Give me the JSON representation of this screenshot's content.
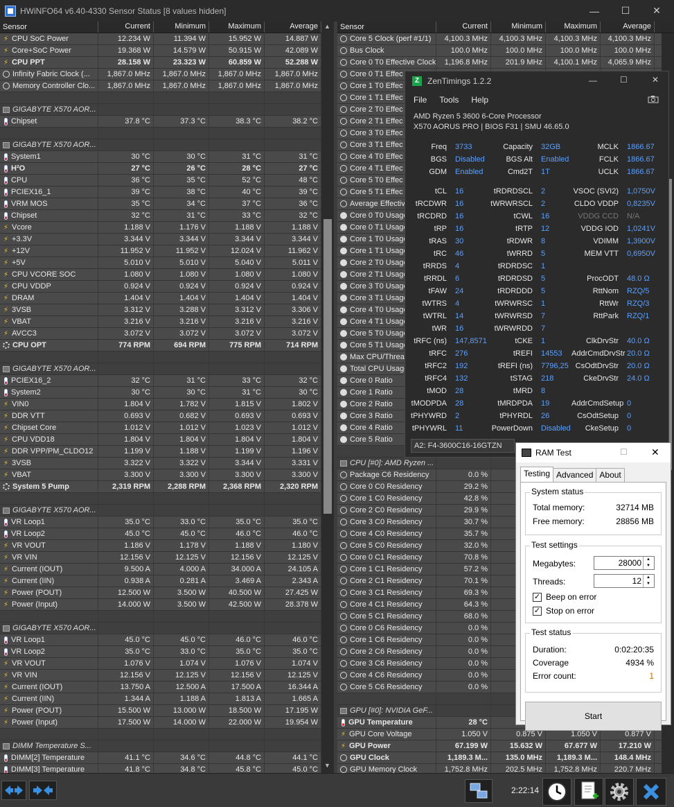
{
  "window": {
    "title": "HWiNFO64 v6.40-4330 Sensor Status [8 values hidden]"
  },
  "headers": {
    "sensor": "Sensor",
    "current": "Current",
    "minimum": "Minimum",
    "maximum": "Maximum",
    "average": "Average"
  },
  "left": [
    {
      "icon": "bolt",
      "name": "CPU SoC Power",
      "cur": "12.234 W",
      "min": "11.394 W",
      "max": "15.952 W",
      "avg": "14.887 W"
    },
    {
      "icon": "bolt",
      "name": "Core+SoC Power",
      "cur": "19.368 W",
      "min": "14.579 W",
      "max": "50.915 W",
      "avg": "42.089 W"
    },
    {
      "icon": "bolt",
      "name": "CPU PPT",
      "cur": "28.158 W",
      "min": "23.323 W",
      "max": "60.859 W",
      "avg": "52.288 W",
      "bold": true
    },
    {
      "icon": "clock",
      "name": "Infinity Fabric Clock (...",
      "cur": "1,867.0 MHz",
      "min": "1,867.0 MHz",
      "max": "1,867.0 MHz",
      "avg": "1,867.0 MHz"
    },
    {
      "icon": "clock",
      "name": "Memory Controller Clo...",
      "cur": "1,867.0 MHz",
      "min": "1,867.0 MHz",
      "max": "1,867.0 MHz",
      "avg": "1,867.0 MHz"
    },
    {
      "blank": true
    },
    {
      "group": true,
      "name": "GIGABYTE X570 AOR..."
    },
    {
      "icon": "therm",
      "name": "Chipset",
      "cur": "37.8 °C",
      "min": "37.3 °C",
      "max": "38.3 °C",
      "avg": "38.2 °C"
    },
    {
      "blank": true
    },
    {
      "group": true,
      "name": "GIGABYTE X570 AOR..."
    },
    {
      "icon": "therm",
      "name": "System1",
      "cur": "30 °C",
      "min": "30 °C",
      "max": "31 °C",
      "avg": "31 °C"
    },
    {
      "icon": "therm",
      "name": "H²O",
      "cur": "27 °C",
      "min": "26 °C",
      "max": "28 °C",
      "avg": "27 °C",
      "bold": true
    },
    {
      "icon": "therm",
      "name": "CPU",
      "cur": "36 °C",
      "min": "35 °C",
      "max": "52 °C",
      "avg": "48 °C"
    },
    {
      "icon": "therm",
      "name": "PCIEX16_1",
      "cur": "39 °C",
      "min": "38 °C",
      "max": "40 °C",
      "avg": "39 °C"
    },
    {
      "icon": "therm",
      "name": "VRM MOS",
      "cur": "35 °C",
      "min": "34 °C",
      "max": "37 °C",
      "avg": "36 °C"
    },
    {
      "icon": "therm",
      "name": "Chipset",
      "cur": "32 °C",
      "min": "31 °C",
      "max": "33 °C",
      "avg": "32 °C"
    },
    {
      "icon": "bolt",
      "name": "Vcore",
      "cur": "1.188 V",
      "min": "1.176 V",
      "max": "1.188 V",
      "avg": "1.188 V"
    },
    {
      "icon": "bolt",
      "name": "+3.3V",
      "cur": "3.344 V",
      "min": "3.344 V",
      "max": "3.344 V",
      "avg": "3.344 V"
    },
    {
      "icon": "bolt",
      "name": "+12V",
      "cur": "11.952 V",
      "min": "11.952 V",
      "max": "12.024 V",
      "avg": "11.962 V"
    },
    {
      "icon": "bolt",
      "name": "+5V",
      "cur": "5.010 V",
      "min": "5.010 V",
      "max": "5.040 V",
      "avg": "5.011 V"
    },
    {
      "icon": "bolt",
      "name": "CPU VCORE SOC",
      "cur": "1.080 V",
      "min": "1.080 V",
      "max": "1.080 V",
      "avg": "1.080 V"
    },
    {
      "icon": "bolt",
      "name": "CPU VDDP",
      "cur": "0.924 V",
      "min": "0.924 V",
      "max": "0.924 V",
      "avg": "0.924 V"
    },
    {
      "icon": "bolt",
      "name": "DRAM",
      "cur": "1.404 V",
      "min": "1.404 V",
      "max": "1.404 V",
      "avg": "1.404 V"
    },
    {
      "icon": "bolt",
      "name": "3VSB",
      "cur": "3.312 V",
      "min": "3.288 V",
      "max": "3.312 V",
      "avg": "3.306 V"
    },
    {
      "icon": "bolt",
      "name": "VBAT",
      "cur": "3.216 V",
      "min": "3.216 V",
      "max": "3.216 V",
      "avg": "3.216 V"
    },
    {
      "icon": "bolt",
      "name": "AVCC3",
      "cur": "3.072 V",
      "min": "3.072 V",
      "max": "3.072 V",
      "avg": "3.072 V"
    },
    {
      "icon": "fan",
      "name": "CPU OPT",
      "cur": "774 RPM",
      "min": "694 RPM",
      "max": "775 RPM",
      "avg": "714 RPM",
      "bold": true
    },
    {
      "blank": true
    },
    {
      "group": true,
      "name": "GIGABYTE X570 AOR..."
    },
    {
      "icon": "therm",
      "name": "PCIEX16_2",
      "cur": "32 °C",
      "min": "31 °C",
      "max": "33 °C",
      "avg": "32 °C"
    },
    {
      "icon": "therm",
      "name": "System2",
      "cur": "30 °C",
      "min": "30 °C",
      "max": "31 °C",
      "avg": "30 °C"
    },
    {
      "icon": "bolt",
      "name": "VIN0",
      "cur": "1.804 V",
      "min": "1.782 V",
      "max": "1.815 V",
      "avg": "1.802 V"
    },
    {
      "icon": "bolt",
      "name": "DDR VTT",
      "cur": "0.693 V",
      "min": "0.682 V",
      "max": "0.693 V",
      "avg": "0.693 V"
    },
    {
      "icon": "bolt",
      "name": "Chipset Core",
      "cur": "1.012 V",
      "min": "1.012 V",
      "max": "1.023 V",
      "avg": "1.012 V"
    },
    {
      "icon": "bolt",
      "name": "CPU VDD18",
      "cur": "1.804 V",
      "min": "1.804 V",
      "max": "1.804 V",
      "avg": "1.804 V"
    },
    {
      "icon": "bolt",
      "name": "DDR VPP/PM_CLDO12",
      "cur": "1.199 V",
      "min": "1.188 V",
      "max": "1.199 V",
      "avg": "1.196 V"
    },
    {
      "icon": "bolt",
      "name": "3VSB",
      "cur": "3.322 V",
      "min": "3.322 V",
      "max": "3.344 V",
      "avg": "3.331 V"
    },
    {
      "icon": "bolt",
      "name": "VBAT",
      "cur": "3.300 V",
      "min": "3.300 V",
      "max": "3.300 V",
      "avg": "3.300 V"
    },
    {
      "icon": "fan",
      "name": "System 5 Pump",
      "cur": "2,319 RPM",
      "min": "2,288 RPM",
      "max": "2,368 RPM",
      "avg": "2,320 RPM",
      "bold": true
    },
    {
      "blank": true
    },
    {
      "group": true,
      "name": "GIGABYTE X570 AOR..."
    },
    {
      "icon": "therm",
      "name": "VR Loop1",
      "cur": "35.0 °C",
      "min": "33.0 °C",
      "max": "35.0 °C",
      "avg": "35.0 °C"
    },
    {
      "icon": "therm",
      "name": "VR Loop2",
      "cur": "45.0 °C",
      "min": "45.0 °C",
      "max": "46.0 °C",
      "avg": "46.0 °C"
    },
    {
      "icon": "bolt",
      "name": "VR VOUT",
      "cur": "1.186 V",
      "min": "1.178 V",
      "max": "1.188 V",
      "avg": "1.180 V"
    },
    {
      "icon": "bolt",
      "name": "VR VIN",
      "cur": "12.156 V",
      "min": "12.125 V",
      "max": "12.156 V",
      "avg": "12.125 V"
    },
    {
      "icon": "bolt",
      "name": "Current (IOUT)",
      "cur": "9.500 A",
      "min": "4.000 A",
      "max": "34.000 A",
      "avg": "24.105 A"
    },
    {
      "icon": "bolt",
      "name": "Current (IIN)",
      "cur": "0.938 A",
      "min": "0.281 A",
      "max": "3.469 A",
      "avg": "2.343 A"
    },
    {
      "icon": "bolt",
      "name": "Power (POUT)",
      "cur": "12.500 W",
      "min": "3.500 W",
      "max": "40.500 W",
      "avg": "27.425 W"
    },
    {
      "icon": "bolt",
      "name": "Power (Input)",
      "cur": "14.000 W",
      "min": "3.500 W",
      "max": "42.500 W",
      "avg": "28.378 W"
    },
    {
      "blank": true
    },
    {
      "group": true,
      "name": "GIGABYTE X570 AOR..."
    },
    {
      "icon": "therm",
      "name": "VR Loop1",
      "cur": "45.0 °C",
      "min": "45.0 °C",
      "max": "46.0 °C",
      "avg": "46.0 °C"
    },
    {
      "icon": "therm",
      "name": "VR Loop2",
      "cur": "35.0 °C",
      "min": "33.0 °C",
      "max": "35.0 °C",
      "avg": "35.0 °C"
    },
    {
      "icon": "bolt",
      "name": "VR VOUT",
      "cur": "1.076 V",
      "min": "1.074 V",
      "max": "1.076 V",
      "avg": "1.074 V"
    },
    {
      "icon": "bolt",
      "name": "VR VIN",
      "cur": "12.156 V",
      "min": "12.125 V",
      "max": "12.156 V",
      "avg": "12.125 V"
    },
    {
      "icon": "bolt",
      "name": "Current (IOUT)",
      "cur": "13.750 A",
      "min": "12.500 A",
      "max": "17.500 A",
      "avg": "16.344 A"
    },
    {
      "icon": "bolt",
      "name": "Current (IIN)",
      "cur": "1.344 A",
      "min": "1.188 A",
      "max": "1.813 A",
      "avg": "1.665 A"
    },
    {
      "icon": "bolt",
      "name": "Power (POUT)",
      "cur": "15.500 W",
      "min": "13.000 W",
      "max": "18.500 W",
      "avg": "17.195 W"
    },
    {
      "icon": "bolt",
      "name": "Power (Input)",
      "cur": "17.500 W",
      "min": "14.000 W",
      "max": "22.000 W",
      "avg": "19.954 W"
    },
    {
      "blank": true
    },
    {
      "group": true,
      "name": "DIMM Temperature S..."
    },
    {
      "icon": "therm",
      "name": "DIMM[2] Temperature",
      "cur": "41.1 °C",
      "min": "34.6 °C",
      "max": "44.8 °C",
      "avg": "44.1 °C"
    },
    {
      "icon": "therm",
      "name": "DIMM[3] Temperature",
      "cur": "41.8 °C",
      "min": "34.8 °C",
      "max": "45.8 °C",
      "avg": "45.0 °C"
    }
  ],
  "right": [
    {
      "icon": "clock",
      "name": "Core 5 Clock (perf #1/1)",
      "cur": "4,100.3 MHz",
      "min": "4,100.3 MHz",
      "max": "4,100.3 MHz",
      "avg": "4,100.3 MHz"
    },
    {
      "icon": "clock",
      "name": "Bus Clock",
      "cur": "100.0 MHz",
      "min": "100.0 MHz",
      "max": "100.0 MHz",
      "avg": "100.0 MHz"
    },
    {
      "icon": "clock",
      "name": "Core 0 T0 Effective Clock",
      "cur": "1,196.8 MHz",
      "min": "201.9 MHz",
      "max": "4,100.1 MHz",
      "avg": "4,065.9 MHz"
    },
    {
      "icon": "clock",
      "name": "Core 0 T1 Effec"
    },
    {
      "icon": "clock",
      "name": "Core 1 T0 Effec"
    },
    {
      "icon": "clock",
      "name": "Core 1 T1 Effec"
    },
    {
      "icon": "clock",
      "name": "Core 2 T0 Effec"
    },
    {
      "icon": "clock",
      "name": "Core 2 T1 Effec"
    },
    {
      "icon": "clock",
      "name": "Core 3 T0 Effec"
    },
    {
      "icon": "clock",
      "name": "Core 3 T1 Effec"
    },
    {
      "icon": "clock",
      "name": "Core 4 T0 Effec"
    },
    {
      "icon": "clock",
      "name": "Core 4 T1 Effec"
    },
    {
      "icon": "clock",
      "name": "Core 5 T0 Effec"
    },
    {
      "icon": "clock",
      "name": "Core 5 T1 Effec"
    },
    {
      "icon": "clock",
      "name": "Average Effectiv"
    },
    {
      "icon": "pct",
      "name": "Core 0 T0 Usage"
    },
    {
      "icon": "pct",
      "name": "Core 0 T1 Usage"
    },
    {
      "icon": "pct",
      "name": "Core 1 T0 Usage"
    },
    {
      "icon": "pct",
      "name": "Core 1 T1 Usage"
    },
    {
      "icon": "pct",
      "name": "Core 2 T0 Usage"
    },
    {
      "icon": "pct",
      "name": "Core 2 T1 Usage"
    },
    {
      "icon": "pct",
      "name": "Core 3 T0 Usage"
    },
    {
      "icon": "pct",
      "name": "Core 3 T1 Usage"
    },
    {
      "icon": "pct",
      "name": "Core 4 T0 Usage"
    },
    {
      "icon": "pct",
      "name": "Core 4 T1 Usage"
    },
    {
      "icon": "pct",
      "name": "Core 5 T0 Usage"
    },
    {
      "icon": "pct",
      "name": "Core 5 T1 Usage"
    },
    {
      "icon": "pct",
      "name": "Max CPU/Thread"
    },
    {
      "icon": "pct",
      "name": "Total CPU Usage"
    },
    {
      "icon": "pct",
      "name": "Core 0 Ratio"
    },
    {
      "icon": "pct",
      "name": "Core 1 Ratio"
    },
    {
      "icon": "pct",
      "name": "Core 2 Ratio"
    },
    {
      "icon": "pct",
      "name": "Core 3 Ratio"
    },
    {
      "icon": "pct",
      "name": "Core 4 Ratio"
    },
    {
      "icon": "pct",
      "name": "Core 5 Ratio"
    },
    {
      "blank": true
    },
    {
      "group": true,
      "name": "CPU [#0]: AMD Ryzen ..."
    },
    {
      "icon": "clock",
      "name": "Package C6 Residency",
      "cur": "0.0 %"
    },
    {
      "icon": "clock",
      "name": "Core 0 C0 Residency",
      "cur": "29.2 %"
    },
    {
      "icon": "clock",
      "name": "Core 1 C0 Residency",
      "cur": "42.8 %"
    },
    {
      "icon": "clock",
      "name": "Core 2 C0 Residency",
      "cur": "29.9 %"
    },
    {
      "icon": "clock",
      "name": "Core 3 C0 Residency",
      "cur": "30.7 %"
    },
    {
      "icon": "clock",
      "name": "Core 4 C0 Residency",
      "cur": "35.7 %"
    },
    {
      "icon": "clock",
      "name": "Core 5 C0 Residency",
      "cur": "32.0 %"
    },
    {
      "icon": "clock",
      "name": "Core 0 C1 Residency",
      "cur": "70.8 %"
    },
    {
      "icon": "clock",
      "name": "Core 1 C1 Residency",
      "cur": "57.2 %"
    },
    {
      "icon": "clock",
      "name": "Core 2 C1 Residency",
      "cur": "70.1 %"
    },
    {
      "icon": "clock",
      "name": "Core 3 C1 Residency",
      "cur": "69.3 %"
    },
    {
      "icon": "clock",
      "name": "Core 4 C1 Residency",
      "cur": "64.3 %"
    },
    {
      "icon": "clock",
      "name": "Core 5 C1 Residency",
      "cur": "68.0 %"
    },
    {
      "icon": "clock",
      "name": "Core 0 C6 Residency",
      "cur": "0.0 %"
    },
    {
      "icon": "clock",
      "name": "Core 1 C6 Residency",
      "cur": "0.0 %"
    },
    {
      "icon": "clock",
      "name": "Core 2 C6 Residency",
      "cur": "0.0 %"
    },
    {
      "icon": "clock",
      "name": "Core 3 C6 Residency",
      "cur": "0.0 %"
    },
    {
      "icon": "clock",
      "name": "Core 4 C6 Residency",
      "cur": "0.0 %"
    },
    {
      "icon": "clock",
      "name": "Core 5 C6 Residency",
      "cur": "0.0 %"
    },
    {
      "blank": true
    },
    {
      "group": true,
      "name": "GPU [#0]: NVIDIA GeF..."
    },
    {
      "icon": "therm",
      "name": "GPU Temperature",
      "cur": "28 °C",
      "bold": true
    },
    {
      "icon": "bolt",
      "name": "GPU Core Voltage",
      "cur": "1.050 V",
      "min": "0.875 V",
      "max": "1.050 V",
      "avg": "0.877 V"
    },
    {
      "icon": "bolt",
      "name": "GPU Power",
      "cur": "67.199 W",
      "min": "15.632 W",
      "max": "67.677 W",
      "avg": "17.210 W",
      "bold": true
    },
    {
      "icon": "clock",
      "name": "GPU Clock",
      "cur": "1,189.3 M...",
      "min": "135.0 MHz",
      "max": "1,189.3 M...",
      "avg": "148.4 MHz",
      "bold": true
    },
    {
      "icon": "clock",
      "name": "GPU Memory Clock",
      "cur": "1,752.8 MHz",
      "min": "202.5 MHz",
      "max": "1,752.8 MHz",
      "avg": "220.7 MHz"
    }
  ],
  "status": {
    "time": "2:22:14"
  },
  "zentimings": {
    "title": "ZenTimings 1.2.2",
    "menu": [
      "File",
      "Tools",
      "Help"
    ],
    "cpu": "AMD Ryzen 5 3600 6-Core Processor",
    "board": "X570 AORUS PRO | BIOS F31 | SMU 46.65.0",
    "rows": [
      [
        [
          "Freq",
          "3733"
        ],
        [
          "Capacity",
          "32GB"
        ],
        [
          "MCLK",
          "1866.67"
        ]
      ],
      [
        [
          "BGS",
          "Disabled"
        ],
        [
          "BGS Alt",
          "Enabled"
        ],
        [
          "FCLK",
          "1866.67"
        ]
      ],
      [
        [
          "GDM",
          "Enabled"
        ],
        [
          "Cmd2T",
          "1T"
        ],
        [
          "UCLK",
          "1866.67"
        ]
      ],
      "gap",
      [
        [
          "tCL",
          "16"
        ],
        [
          "tRDRDSCL",
          "2"
        ],
        [
          "VSOC (SVI2)",
          "1,0750V"
        ]
      ],
      [
        [
          "tRCDWR",
          "16"
        ],
        [
          "tWRWRSCL",
          "2"
        ],
        [
          "CLDO VDDP",
          "0,8235V"
        ]
      ],
      [
        [
          "tRCDRD",
          "16"
        ],
        [
          "tCWL",
          "16"
        ],
        [
          "VDDG CCD",
          "N/A"
        ]
      ],
      [
        [
          "tRP",
          "16"
        ],
        [
          "tRTP",
          "12"
        ],
        [
          "VDDG IOD",
          "1,0241V"
        ]
      ],
      [
        [
          "tRAS",
          "30"
        ],
        [
          "tRDWR",
          "8"
        ],
        [
          "VDIMM",
          "1,3900V"
        ]
      ],
      [
        [
          "tRC",
          "46"
        ],
        [
          "tWRRD",
          "5"
        ],
        [
          "MEM VTT",
          "0,6950V"
        ]
      ],
      [
        [
          "tRRDS",
          "4"
        ],
        [
          "tRDRDSC",
          "1"
        ],
        [
          "",
          ""
        ]
      ],
      [
        [
          "tRRDL",
          "6"
        ],
        [
          "tRDRDSD",
          "5"
        ],
        [
          "ProcODT",
          "48.0 Ω"
        ]
      ],
      [
        [
          "tFAW",
          "24"
        ],
        [
          "tRDRDDD",
          "5"
        ],
        [
          "RttNom",
          "RZQ/5"
        ]
      ],
      [
        [
          "tWTRS",
          "4"
        ],
        [
          "tWRWRSC",
          "1"
        ],
        [
          "RttWr",
          "RZQ/3"
        ]
      ],
      [
        [
          "tWTRL",
          "14"
        ],
        [
          "tWRWRSD",
          "7"
        ],
        [
          "RttPark",
          "RZQ/1"
        ]
      ],
      [
        [
          "tWR",
          "16"
        ],
        [
          "tWRWRDD",
          "7"
        ],
        [
          "",
          ""
        ]
      ],
      [
        [
          "tRFC (ns)",
          "147,8571"
        ],
        [
          "tCKE",
          "1"
        ],
        [
          "ClkDrvStr",
          "40.0 Ω"
        ]
      ],
      [
        [
          "tRFC",
          "276"
        ],
        [
          "tREFI",
          "14553"
        ],
        [
          "AddrCmdDrvStr",
          "20.0 Ω"
        ]
      ],
      [
        [
          "tRFC2",
          "192"
        ],
        [
          "tREFI (ns)",
          "7796,25"
        ],
        [
          "CsOdtDrvStr",
          "20.0 Ω"
        ]
      ],
      [
        [
          "tRFC4",
          "132"
        ],
        [
          "tSTAG",
          "218"
        ],
        [
          "CkeDrvStr",
          "24.0 Ω"
        ]
      ],
      [
        [
          "tMOD",
          "28"
        ],
        [
          "tMRD",
          "8"
        ],
        [
          "",
          ""
        ]
      ],
      [
        [
          "tMODPDA",
          "28"
        ],
        [
          "tMRDPDA",
          "19"
        ],
        [
          "AddrCmdSetup",
          "0"
        ]
      ],
      [
        [
          "tPHYWRD",
          "2"
        ],
        [
          "tPHYRDL",
          "26"
        ],
        [
          "CsOdtSetup",
          "0"
        ]
      ],
      [
        [
          "tPHYWRL",
          "11"
        ],
        [
          "PowerDown",
          "Disabled"
        ],
        [
          "CkeSetup",
          "0"
        ]
      ]
    ],
    "combo": "A2: F4-3600C16-16GTZN"
  },
  "ramtest": {
    "title": "RAM Test",
    "tabs": [
      "Testing",
      "Advanced",
      "About"
    ],
    "system_status": "System status",
    "total_label": "Total memory:",
    "total": "32714 MB",
    "free_label": "Free memory:",
    "free": "28856 MB",
    "test_settings": "Test settings",
    "mb_label": "Megabytes:",
    "mb": "28000",
    "threads_label": "Threads:",
    "threads": "12",
    "beep": "Beep on error",
    "stop": "Stop on error",
    "test_status": "Test status",
    "duration_label": "Duration:",
    "duration": "0:02:20:35",
    "coverage_label": "Coverage",
    "coverage": "4934 %",
    "errors_label": "Error count:",
    "errors": "1",
    "start": "Start"
  },
  "colors": {
    "zt_value": "#5aa0ff",
    "accent": "#f2c230"
  }
}
